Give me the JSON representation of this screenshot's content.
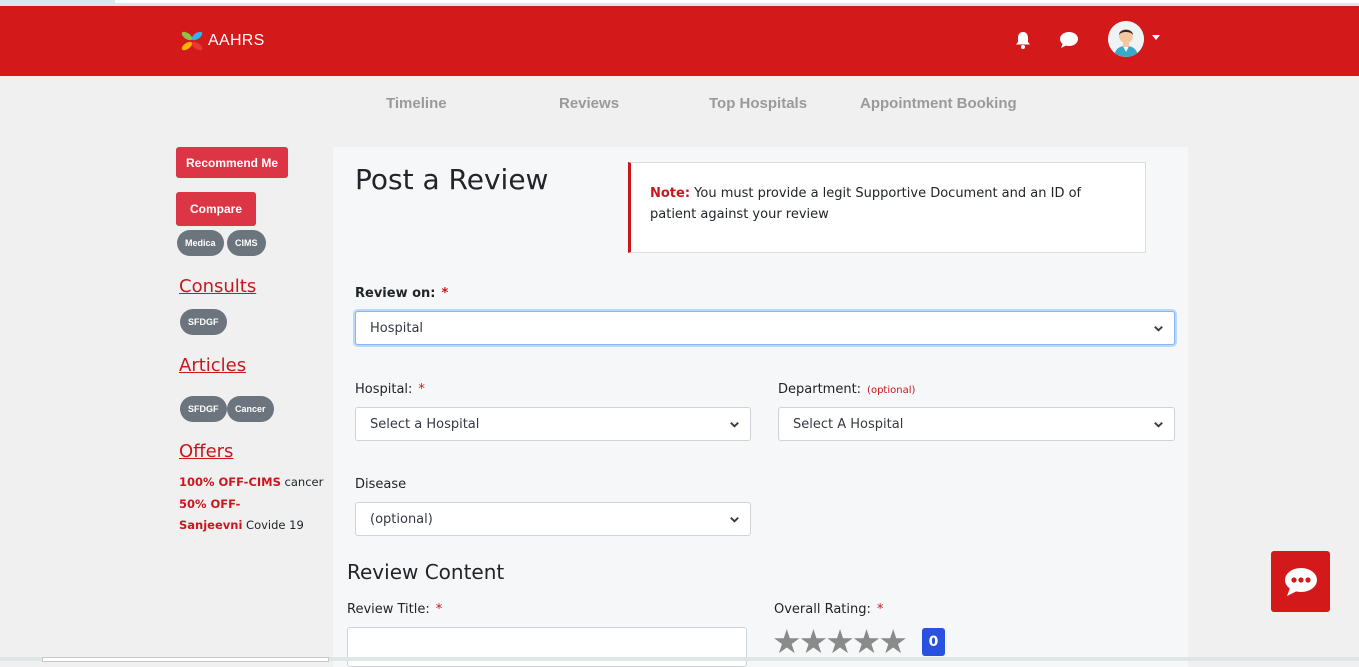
{
  "brand": {
    "name": "AAHRS"
  },
  "header": {
    "icons": [
      "bell-icon",
      "chat-bubble-icon",
      "user-avatar",
      "chevron-down-icon"
    ]
  },
  "subnav": [
    "Timeline",
    "Reviews",
    "Top Hospitals",
    "Appointment Booking"
  ],
  "sidebar": {
    "recommend_label": "Recommend Me",
    "compare_label": "Compare",
    "compare_tags": [
      "Medica",
      "CIMS"
    ],
    "consults_heading": "Consults",
    "consults_tags": [
      "SFDGF"
    ],
    "articles_heading": "Articles",
    "articles_tags": [
      "SFDGF",
      "Cancer"
    ],
    "offers_heading": "Offers",
    "offers": [
      {
        "highlight": "100% OFF-CIMS",
        "text": " cancer"
      },
      {
        "highlight": "50% OFF-",
        "text": ""
      },
      {
        "highlight": "Sanjeevni",
        "text": " Covide 19"
      }
    ]
  },
  "form": {
    "title": "Post a Review",
    "note_label": "Note:",
    "note_text": " You must provide a legit Supportive Document and an ID of patient against your review",
    "review_on_label": "Review on:",
    "required_mark": "*",
    "review_on_value": "Hospital",
    "hospital_label": "Hospital:",
    "hospital_value": "Select a Hospital",
    "department_label": "Department:",
    "department_optional": "(optional)",
    "department_value": "Select A Hospital",
    "disease_label": "Disease",
    "disease_value": "(optional)",
    "content_heading": "Review Content",
    "review_title_label": "Review Title:",
    "review_title_value": "",
    "rating_label": "Overall Rating:",
    "rating_value": "0",
    "rating_stars_total": 5
  },
  "colors": {
    "brand_red": "#d4191b",
    "accent_red": "#dc3545",
    "badge_blue": "#2952e0",
    "tag_gray": "#6c757d"
  }
}
